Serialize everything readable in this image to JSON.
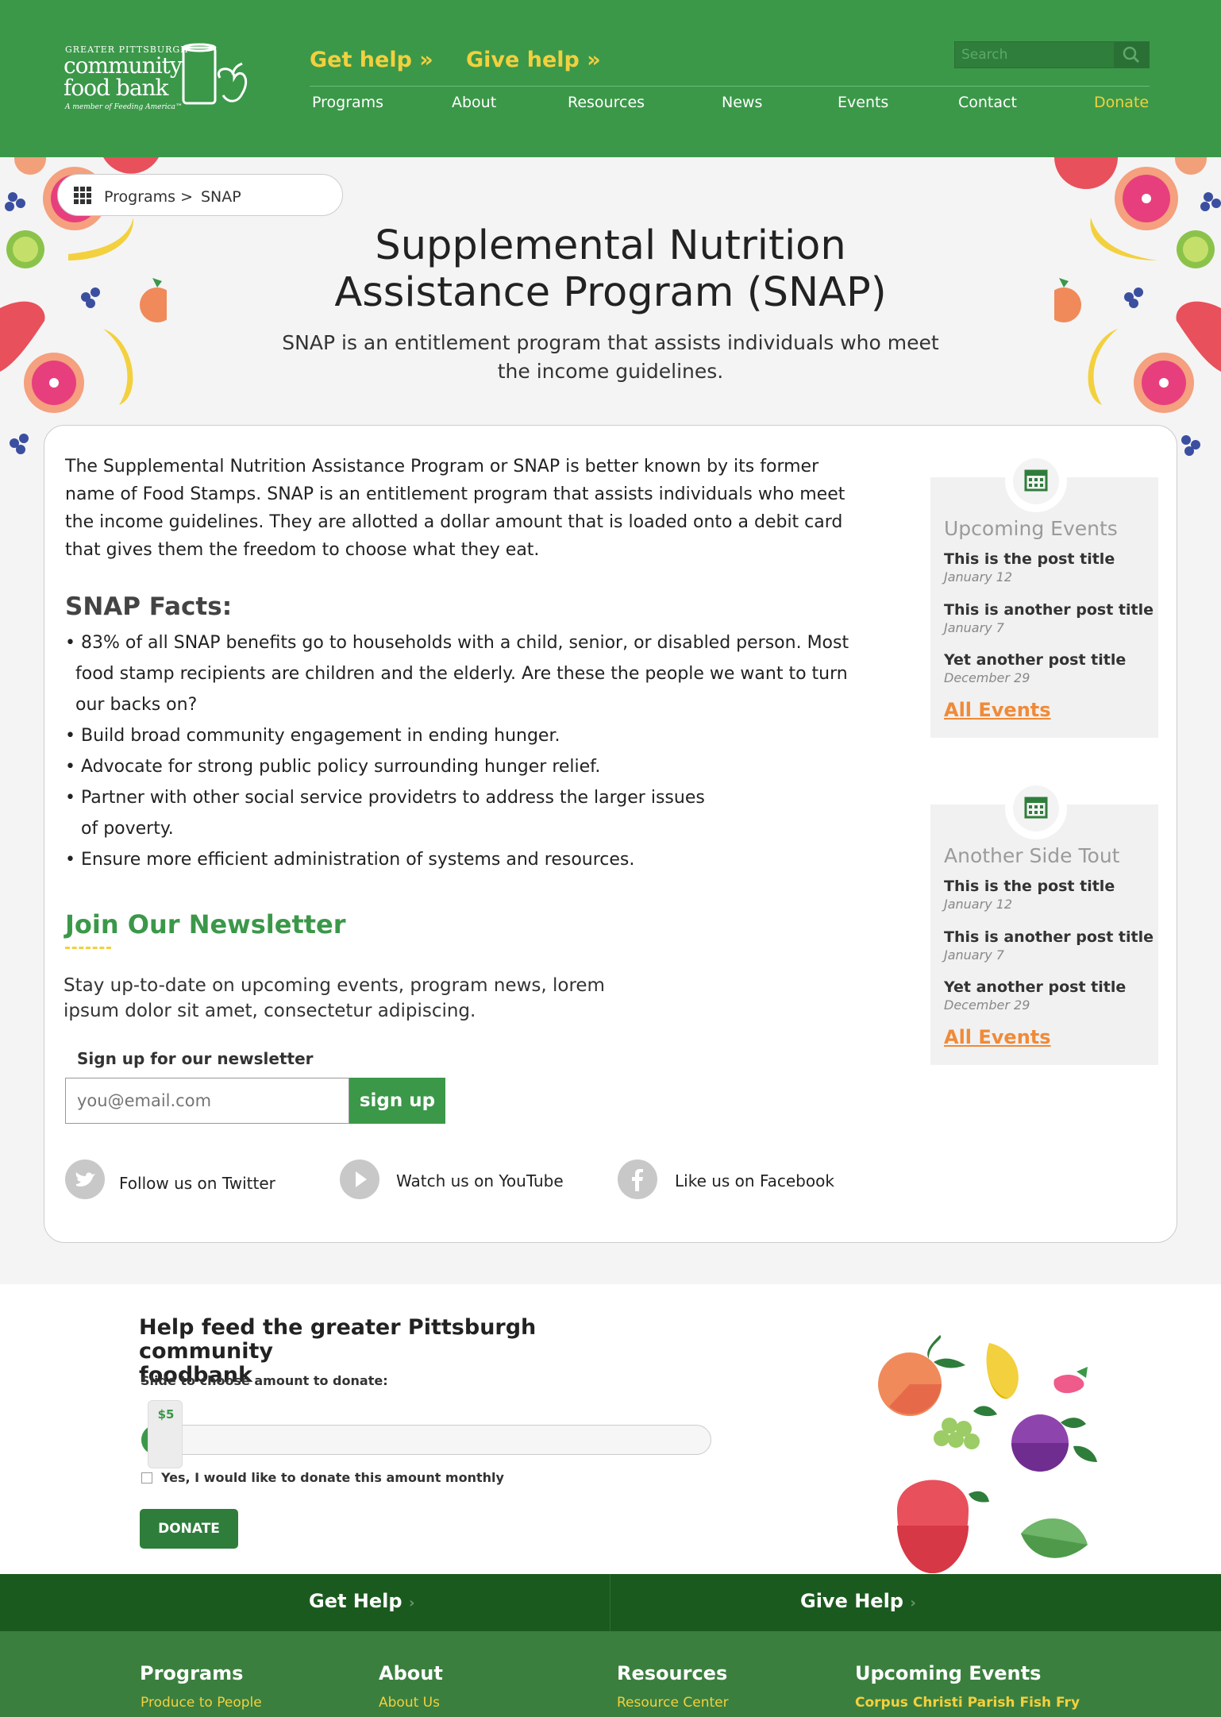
{
  "header": {
    "logo": {
      "line1": "GREATER PITTSBURGH",
      "line2": "community",
      "line3": "food bank",
      "tagline": "A member of Feeding America™"
    },
    "get_help": "Get help »",
    "give_help": "Give help »",
    "search_placeholder": "Search",
    "nav": [
      "Programs",
      "About",
      "Resources",
      "News",
      "Events",
      "Contact",
      "Donate"
    ]
  },
  "breadcrumb": {
    "parent": "Programs >",
    "current": "SNAP"
  },
  "hero": {
    "title_line1": "Supplemental Nutrition",
    "title_line2": "Assistance Program (SNAP)",
    "lede_line1": "SNAP is an entitlement program that assists individuals who meet",
    "lede_line2": "the income guidelines."
  },
  "intro": [
    "The Supplemental Nutrition Assistance Program or SNAP is better known by its former",
    "name of Food Stamps.  SNAP is an entitlement program that assists individuals who meet",
    "the income guidelines. They are allotted a dollar amount  that is loaded onto a debit card",
    "that gives them the freedom to choose what they eat."
  ],
  "facts": {
    "heading": "SNAP Facts:",
    "lines": [
      "• 83% of all SNAP benefits go to households with a child, senior, or disabled person. Most",
      "food stamp recipients are children and the elderly. Are these the people we want to turn",
      "our backs on?",
      "• Build broad community engagement in ending hunger.",
      "• Advocate for strong public policy surrounding hunger relief.",
      "• Partner with other social service providetrs to address the larger issues",
      "of poverty.",
      "• Ensure more efficient administration of systems and resources."
    ]
  },
  "newsletter": {
    "heading": "Join Our Newsletter",
    "text_line1": "Stay up-to-date on upcoming events, program news, lorem",
    "text_line2": "ipsum dolor sit amet, consectetur adipiscing.",
    "label": "Sign up for our newsletter",
    "placeholder": "you@email.com",
    "button": "sign up"
  },
  "social": {
    "twitter": "Follow us on Twitter",
    "youtube": "Watch us on YouTube",
    "facebook": "Like us on Facebook"
  },
  "sidebar": [
    {
      "title": "Upcoming Events",
      "posts": [
        {
          "title": "This is the post title",
          "date": "January 12"
        },
        {
          "title": "This is another post title",
          "date": "January 7"
        },
        {
          "title": "Yet another post title",
          "date": "December 29"
        }
      ],
      "link": "All Events"
    },
    {
      "title": "Another Side Tout",
      "posts": [
        {
          "title": "This is the post title",
          "date": "January 12"
        },
        {
          "title": "This is another post title",
          "date": "January 7"
        },
        {
          "title": "Yet another post title",
          "date": "December 29"
        }
      ],
      "link": "All Events"
    }
  ],
  "donate": {
    "heading_line1": "Help feed the greater Pittsburgh community",
    "heading_line2": "foodbank",
    "slider_label": "Slide to choose amount to donate:",
    "amount": "$5",
    "slider_fraction": 0.06,
    "monthly_label": "Yes, I would like to donate this amount monthly",
    "button": "DONATE"
  },
  "footer": {
    "get_help": "Get Help",
    "give_help": "Give Help",
    "columns": [
      {
        "heading": "Programs",
        "link": "Produce to People"
      },
      {
        "heading": "About",
        "link": "About Us"
      },
      {
        "heading": "Resources",
        "link": "Resource Center"
      },
      {
        "heading": "Upcoming Events",
        "link": "Corpus Christi Parish Fish Fry"
      }
    ]
  },
  "colors": {
    "brand_green": "#3b9849",
    "accent_yellow": "#f3d03e",
    "link_orange": "#f08a38",
    "footer_dark": "#1b5a1f"
  }
}
